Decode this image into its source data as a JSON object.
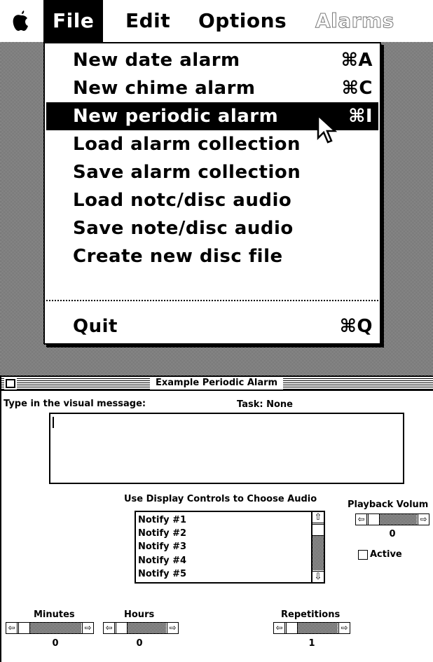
{
  "menubar": {
    "apple": "🍎",
    "items": [
      "File",
      "Edit",
      "Options",
      "Alarms"
    ]
  },
  "file_menu": {
    "items": [
      {
        "label": "New date alarm",
        "shortcut": "⌘A"
      },
      {
        "label": "New chime alarm",
        "shortcut": "⌘C"
      },
      {
        "label": "New periodic alarm",
        "shortcut": "⌘I"
      },
      {
        "label": "Load alarm collection",
        "shortcut": ""
      },
      {
        "label": "Save alarm collection",
        "shortcut": ""
      },
      {
        "label": "Load notc/disc audio",
        "shortcut": ""
      },
      {
        "label": "Save note/disc audio",
        "shortcut": ""
      },
      {
        "label": "Create new disc file",
        "shortcut": ""
      },
      {
        "label": "Quit",
        "shortcut": "⌘Q"
      }
    ],
    "highlighted": "New periodic alarm"
  },
  "window": {
    "title": "Example Periodic Alarm",
    "visual_message_label": "Type in the visual message:",
    "task_label": "Task: None",
    "visual_message_value": "",
    "audio_label": "Use Display Controls to Choose Audio",
    "audio_list": [
      "Notify #1",
      "Notify #2",
      "Notify #3",
      "Notify #4",
      "Notify #5"
    ],
    "playback_label": "Playback Volum",
    "playback_value": "0",
    "active_label": "Active",
    "active_checked": false,
    "minutes_label": "Minutes",
    "minutes_value": "0",
    "hours_label": "Hours",
    "hours_value": "0",
    "repetitions_label": "Repetitions",
    "repetitions_value": "1"
  },
  "icons": {
    "scroll_left": "⇦",
    "scroll_right": "⇨",
    "scroll_up": "⇧",
    "scroll_down": "⇩"
  }
}
